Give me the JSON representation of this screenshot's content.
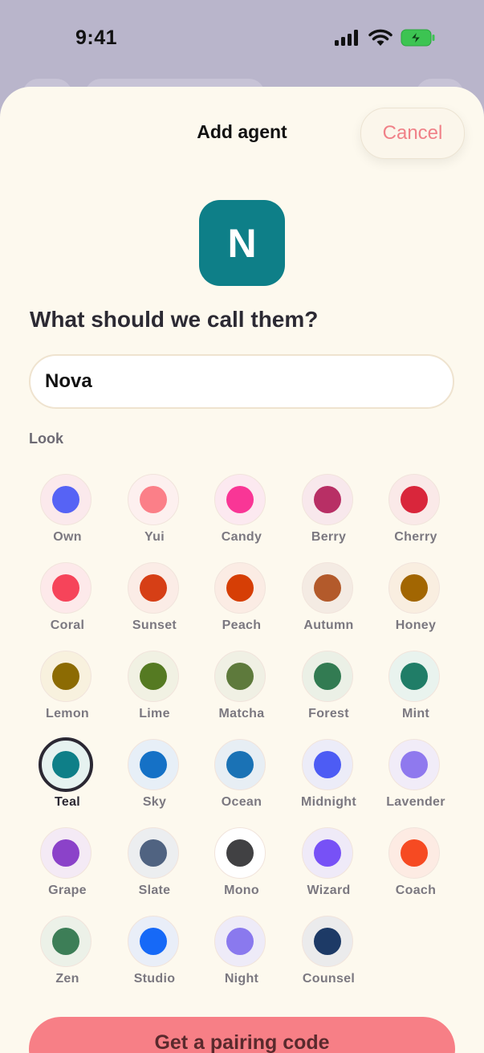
{
  "status": {
    "time": "9:41"
  },
  "header": {
    "title": "Add agent",
    "cancel_label": "Cancel"
  },
  "agent": {
    "initial": "N",
    "accent": "#0e7f88"
  },
  "form": {
    "question": "What should we call them?",
    "name_value": "Nova",
    "look_label": "Look"
  },
  "swatches": [
    {
      "name": "Own",
      "color": "#5663f5",
      "ring": "#fbe9ec"
    },
    {
      "name": "Yui",
      "color": "#fb7f88",
      "ring": "#fdf0ef"
    },
    {
      "name": "Candy",
      "color": "#f93696",
      "ring": "#fce9f0"
    },
    {
      "name": "Berry",
      "color": "#b82f65",
      "ring": "#f8e8ec"
    },
    {
      "name": "Cherry",
      "color": "#d9263b",
      "ring": "#fae9e8"
    },
    {
      "name": "Coral",
      "color": "#f6445a",
      "ring": "#fde9ea"
    },
    {
      "name": "Sunset",
      "color": "#d63f16",
      "ring": "#fbece6"
    },
    {
      "name": "Peach",
      "color": "#d63e05",
      "ring": "#fbece4"
    },
    {
      "name": "Autumn",
      "color": "#b35a2b",
      "ring": "#f4ebe3"
    },
    {
      "name": "Honey",
      "color": "#a26602",
      "ring": "#f9eee0"
    },
    {
      "name": "Lemon",
      "color": "#8c6b03",
      "ring": "#f8f1de"
    },
    {
      "name": "Lime",
      "color": "#557a22",
      "ring": "#f1f1e3"
    },
    {
      "name": "Matcha",
      "color": "#5e7a3c",
      "ring": "#f0f0e4"
    },
    {
      "name": "Forest",
      "color": "#327b52",
      "ring": "#ebf0e6"
    },
    {
      "name": "Mint",
      "color": "#207d67",
      "ring": "#e9f3ee"
    },
    {
      "name": "Teal",
      "color": "#0e7f88",
      "ring": "#e6f2f0",
      "selected": true
    },
    {
      "name": "Sky",
      "color": "#1571c6",
      "ring": "#e7eff7"
    },
    {
      "name": "Ocean",
      "color": "#1a72b5",
      "ring": "#e7eef4"
    },
    {
      "name": "Midnight",
      "color": "#4d5cf4",
      "ring": "#ececf8"
    },
    {
      "name": "Lavender",
      "color": "#8f79ee",
      "ring": "#f1ecf8"
    },
    {
      "name": "Grape",
      "color": "#8b42c9",
      "ring": "#f4eaf5"
    },
    {
      "name": "Slate",
      "color": "#506381",
      "ring": "#eceef0"
    },
    {
      "name": "Mono",
      "color": "#414143",
      "ring": "#ffffff"
    },
    {
      "name": "Wizard",
      "color": "#7751f6",
      "ring": "#efeaf8"
    },
    {
      "name": "Coach",
      "color": "#f64a22",
      "ring": "#fdebe3"
    },
    {
      "name": "Zen",
      "color": "#3d7e57",
      "ring": "#ecf1e8"
    },
    {
      "name": "Studio",
      "color": "#1669f7",
      "ring": "#e9eef8"
    },
    {
      "name": "Night",
      "color": "#8a79ee",
      "ring": "#eeebf8"
    },
    {
      "name": "Counsel",
      "color": "#1d3a66",
      "ring": "#ebebec"
    }
  ],
  "cta": {
    "label": "Get a pairing code"
  }
}
